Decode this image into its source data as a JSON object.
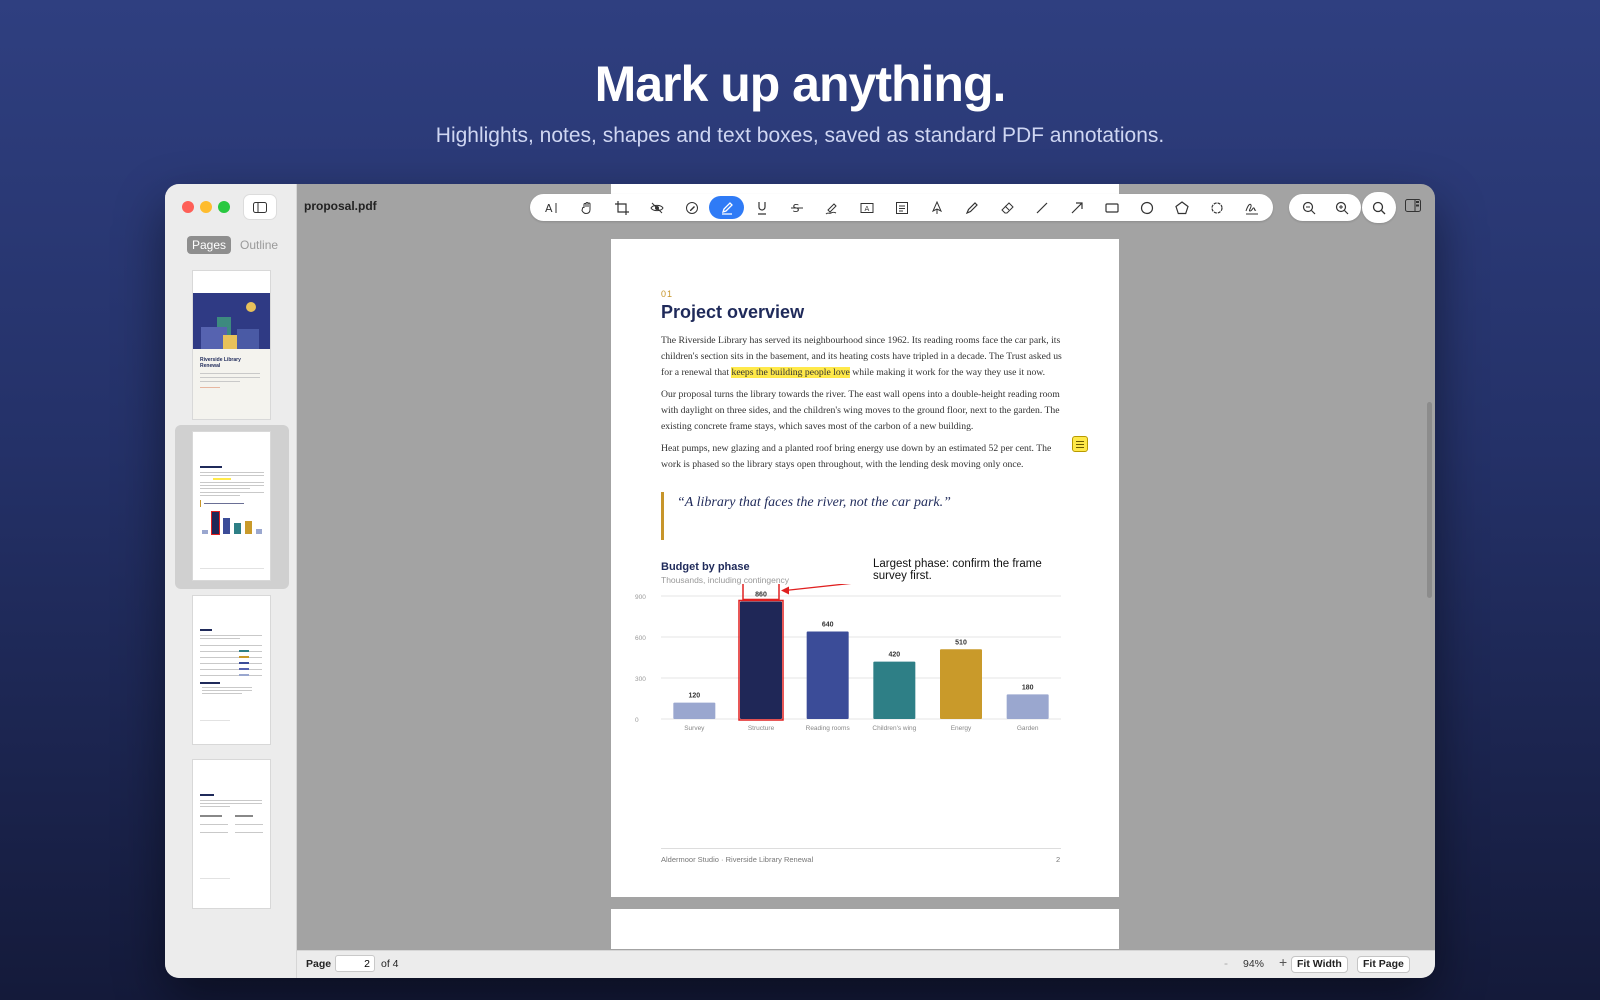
{
  "hero": {
    "title": "Mark up anything.",
    "subtitle": "Highlights, notes, shapes and text boxes, saved as standard PDF annotations."
  },
  "window": {
    "file_name": "proposal.pdf"
  },
  "sidebar": {
    "tabs": [
      "Pages",
      "Outline"
    ],
    "active_tab": "Pages",
    "selected_page": 2,
    "cover_thumb_title": "Riverside Library Renewal"
  },
  "toolbar": {
    "tools": [
      "text-select-icon",
      "hand-icon",
      "crop-icon",
      "redact-eye-icon",
      "annotate-icon",
      "highlight-pen-icon",
      "underline-icon",
      "strikethrough-icon",
      "squiggle-icon",
      "text-box-icon",
      "note-icon",
      "ink-icon",
      "pencil-icon",
      "eraser-icon",
      "line-icon",
      "arrow-icon",
      "rectangle-icon",
      "ellipse-icon",
      "polygon-icon",
      "cloud-icon",
      "signature-icon"
    ],
    "active_tool": "highlight-pen-icon"
  },
  "document": {
    "section_number": "01",
    "heading": "Project overview",
    "para1_a": "The Riverside Library has served its neighbourhood since 1962. Its reading rooms face the car park, its children's section sits in the basement, and its heating costs have tripled in a decade. The Trust asked us for a renewal that ",
    "para1_highlight": "keeps the building people love",
    "para1_b": " while making it work for the way they use it now.",
    "para2": "Our proposal turns the library towards the river. The east wall opens into a double-height reading room with daylight on three sides, and the children's wing moves to the ground floor, next to the garden. The existing concrete frame stays, which saves most of the carbon of a new building.",
    "para3": "Heat pumps, new glazing and a planted roof bring energy use down by an estimated 52 per cent. The work is phased so the library stays open throughout, with the lending desk moving only once.",
    "quote": "“A library that faces the river, not the car park.”",
    "callout": "Largest phase: confirm the frame survey first.",
    "footer_left": "Aldermoor Studio · Riverside Library Renewal",
    "footer_right": "2"
  },
  "chart_data": {
    "type": "bar",
    "title": "Budget by phase",
    "subtitle": "Thousands, including contingency",
    "categories": [
      "Survey",
      "Structure",
      "Reading rooms",
      "Children's wing",
      "Energy",
      "Garden"
    ],
    "values": [
      120,
      860,
      640,
      420,
      510,
      180
    ],
    "colors": [
      "#9aa7cf",
      "#1f2757",
      "#3b4c98",
      "#2e7f86",
      "#c99a2a",
      "#9aa7cf"
    ],
    "yticks": [
      0,
      300,
      600,
      900
    ],
    "ylim": [
      0,
      900
    ],
    "highlighted_category": "Structure",
    "annotation_color": "#e02020"
  },
  "status": {
    "page_label": "Page",
    "page_value": "2",
    "of_label": "of 4",
    "minus": "-",
    "zoom": "94%",
    "plus": "+",
    "fit_width": "Fit Width",
    "fit_page": "Fit Page"
  }
}
